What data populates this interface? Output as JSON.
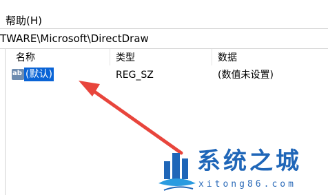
{
  "menubar": {
    "help_label": "帮助(H)"
  },
  "addressbar": {
    "path": "TWARE\\Microsoft\\DirectDraw"
  },
  "columns": {
    "name": "名称",
    "type": "类型",
    "data": "数据"
  },
  "row": {
    "icon_label": "ab",
    "name": "(默认)",
    "type": "REG_SZ",
    "data": "(数值未设置)"
  },
  "watermark": {
    "title": "系统之城",
    "url": "xitong86.com"
  },
  "colors": {
    "selection": "#0a64d6",
    "arrow": "#e8453c",
    "brand": "#1f66b8"
  }
}
